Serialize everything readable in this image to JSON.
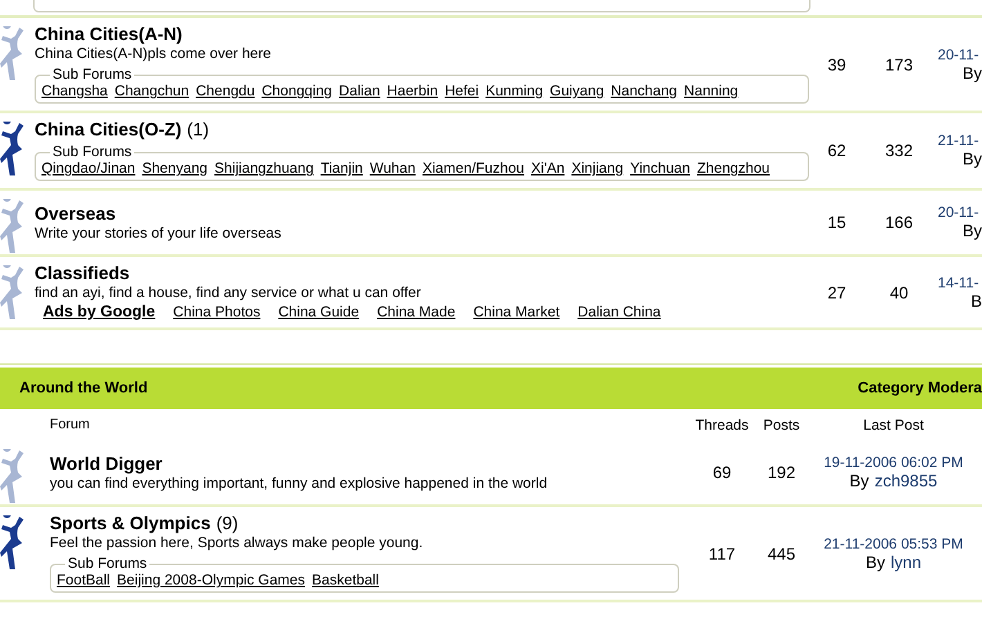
{
  "categories": [
    {
      "forums": [
        {
          "title": "China Cities(A-N)",
          "description": "China Cities(A-N)pls come over here",
          "has_new": false,
          "subforums_label": "Sub Forums",
          "subforums": [
            "Changsha",
            "Changchun",
            "Chengdu",
            "Chongqing",
            "Dalian",
            "Haerbin",
            "Hefei",
            "Kunming",
            "Guiyang",
            "Nanchang",
            "Nanning"
          ],
          "threads": "39",
          "posts": "173",
          "last_date": "20-11-",
          "last_by": "By"
        },
        {
          "title": "China Cities(O-Z)",
          "count": "(1)",
          "has_new": true,
          "subforums_label": "Sub Forums",
          "subforums": [
            "Qingdao/Jinan",
            "Shenyang",
            "Shijiangzhuang",
            "Tianjin",
            "Wuhan",
            "Xiamen/Fuzhou",
            "Xi'An",
            "Xinjiang",
            "Yinchuan",
            "Zhengzhou"
          ],
          "threads": "62",
          "posts": "332",
          "last_date": "21-11-",
          "last_by": "By"
        },
        {
          "title": "Overseas",
          "description": "Write your stories of your life overseas",
          "has_new": false,
          "threads": "15",
          "posts": "166",
          "last_date": "20-11-",
          "last_by": "By"
        },
        {
          "title": "Classifieds",
          "description": "find an ayi, find a house, find any service or what u can offer",
          "has_new": false,
          "ads": {
            "label": "Ads by Google",
            "links": [
              "China Photos",
              "China Guide",
              "China Made",
              "China Market",
              "Dalian China"
            ]
          },
          "threads": "27",
          "posts": "40",
          "last_date": "14-11-",
          "last_by": "B"
        }
      ]
    },
    {
      "title": "Around the World",
      "moderator_label": "Category Modera",
      "columns": {
        "forum": "Forum",
        "threads": "Threads",
        "posts": "Posts",
        "last_post": "Last Post"
      },
      "forums": [
        {
          "title": "World Digger",
          "description": "you can find everything important, funny and explosive happened in the world",
          "has_new": false,
          "threads": "69",
          "posts": "192",
          "last_date": "19-11-2006 06:02 PM",
          "last_by": "By",
          "last_user": "zch9855"
        },
        {
          "title": "Sports & Olympics",
          "count": "(9)",
          "description": "Feel the passion here, Sports always make people young.",
          "has_new": true,
          "subforums_label": "Sub Forums",
          "subforums": [
            "FootBall",
            "Beijing 2008-Olympic Games",
            "Basketball"
          ],
          "threads": "117",
          "posts": "445",
          "last_date": "21-11-2006 05:53 PM",
          "last_by": "By",
          "last_user": "lynn"
        }
      ]
    }
  ]
}
